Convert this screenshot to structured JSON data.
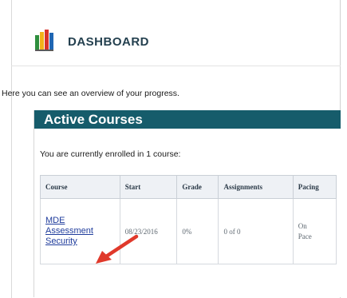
{
  "header": {
    "title": "Dashboard",
    "logo_icon": "book-stack-icon"
  },
  "intro": "Here you can see an overview of your progress.",
  "panel": {
    "title": "Active Courses",
    "enrolled_text": "You are currently enrolled in 1 course:",
    "accent_color": "#165c6b"
  },
  "table": {
    "headers": [
      "Course",
      "Start",
      "Grade",
      "Assignments",
      "Pacing"
    ],
    "rows": [
      {
        "course": "MDE\nAssessment\nSecurity",
        "start": "08/23/2016",
        "grade": "0%",
        "assignments": "0 of 0",
        "pacing": "On\nPace"
      }
    ]
  },
  "annotation": {
    "arrow_icon": "red-pointer-arrow-icon",
    "arrow_color": "#e0392b"
  }
}
